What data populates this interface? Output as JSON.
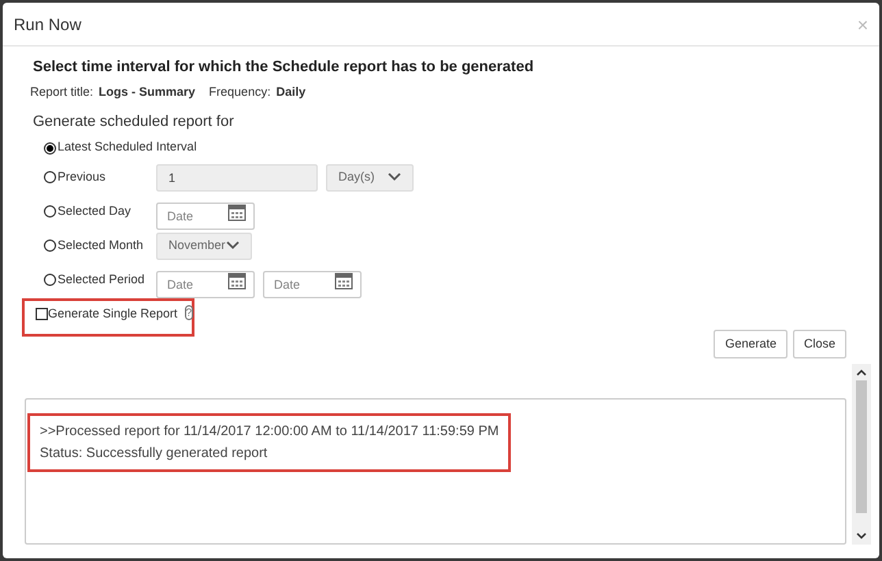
{
  "window": {
    "title": "Run Now",
    "close": "×"
  },
  "heading": "Select time interval for which the Schedule report has to be generated",
  "report_title": {
    "label": "Report title:",
    "value": "Logs - Summary"
  },
  "frequency": {
    "label": "Frequency:",
    "value": "Daily"
  },
  "section_label": "Generate scheduled report for",
  "options": [
    {
      "kind": "plain",
      "label": "Latest Scheduled Interval",
      "selected": true
    },
    {
      "kind": "previous",
      "label": "Previous",
      "selected": false,
      "value": "1",
      "unit": "Day(s)"
    },
    {
      "kind": "day",
      "label": "Selected Day",
      "selected": false,
      "placeholder": "Date"
    },
    {
      "kind": "month",
      "label": "Selected Month",
      "selected": false,
      "value": "November"
    },
    {
      "kind": "period",
      "label": "Selected Period",
      "selected": false,
      "placeholder": "Date",
      "placeholder_2": "Date"
    }
  ],
  "single_report": {
    "label": "Generate Single Report",
    "checked": false,
    "help": "?"
  },
  "buttons": [
    "Generate",
    "Close"
  ],
  "log": [
    ">>Processed report for 11/14/2017 12:00:00 AM to 11/14/2017 11:59:59 PM",
    "Status: Successfully generated report"
  ]
}
